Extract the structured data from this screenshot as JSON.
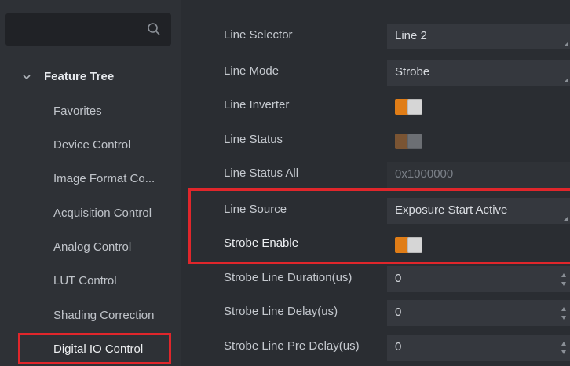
{
  "sidebar": {
    "search_placeholder": "",
    "tree_label": "Feature Tree",
    "items": [
      {
        "label": "Favorites"
      },
      {
        "label": "Device Control"
      },
      {
        "label": "Image Format Co..."
      },
      {
        "label": "Acquisition Control"
      },
      {
        "label": "Analog Control"
      },
      {
        "label": "LUT Control"
      },
      {
        "label": "Shading Correction"
      },
      {
        "label": "Digital IO Control"
      }
    ],
    "active_item": "Digital IO Control"
  },
  "properties": [
    {
      "label": "Line Selector",
      "value": "Line 2",
      "kind": "dropdown"
    },
    {
      "label": "Line Mode",
      "value": "Strobe",
      "kind": "dropdown"
    },
    {
      "label": "Line Inverter",
      "value": "",
      "kind": "toggle-on"
    },
    {
      "label": "Line Status",
      "value": "",
      "kind": "toggle-disabled"
    },
    {
      "label": "Line Status All",
      "value": "0x1000000",
      "kind": "readonly"
    },
    {
      "label": "Line Source",
      "value": "Exposure Start Active",
      "kind": "dropdown"
    },
    {
      "label": "Strobe Enable",
      "value": "",
      "kind": "toggle-on"
    },
    {
      "label": "Strobe Line Duration(us)",
      "value": "0",
      "kind": "spinner"
    },
    {
      "label": "Strobe Line Delay(us)",
      "value": "0",
      "kind": "spinner"
    },
    {
      "label": "Strobe Line Pre Delay(us)",
      "value": "0",
      "kind": "spinner"
    }
  ],
  "colors": {
    "accent_orange": "#e07d17",
    "highlight_red": "#e0262b",
    "background": "#2a2d32",
    "field_bg": "#35383e"
  },
  "icons": [
    "search-icon",
    "chevron-down-icon",
    "dropdown-corner-icon",
    "spinner-arrows-icon"
  ]
}
